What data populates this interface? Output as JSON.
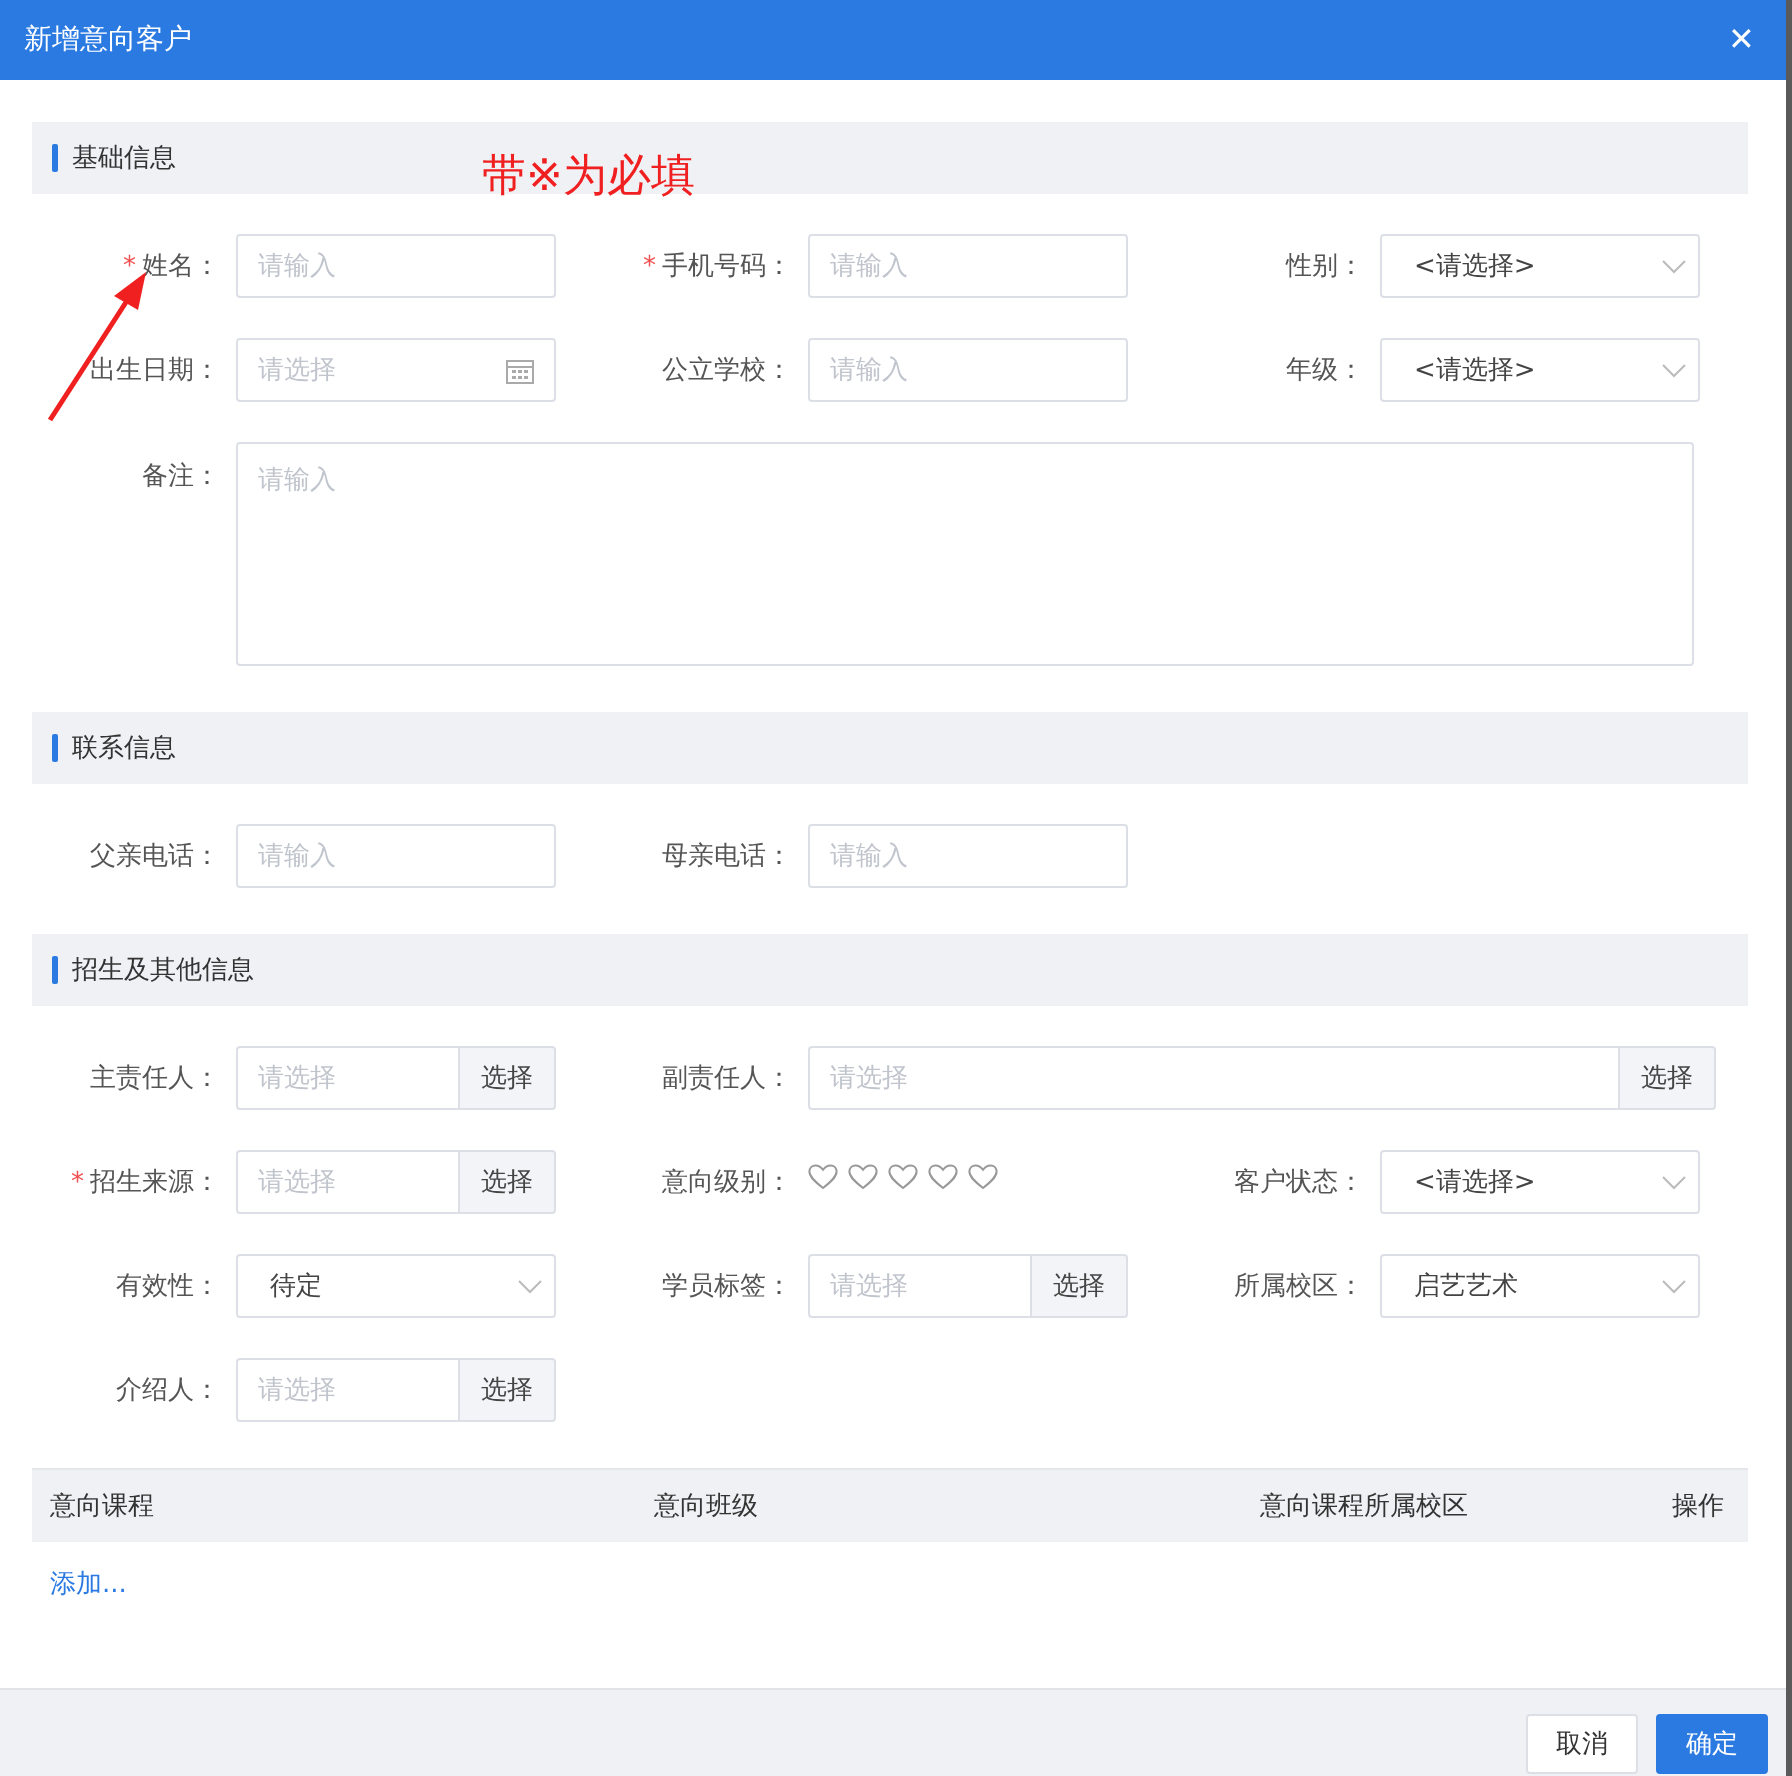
{
  "window": {
    "title": "新增意向客户",
    "close": "✕"
  },
  "annotation": {
    "text": "带※为必填"
  },
  "sections": [
    {
      "title": "基础信息",
      "rows": [
        [
          {
            "label": "姓名：",
            "required_mark": "*",
            "kind": "text",
            "placeholder": "请输入"
          },
          {
            "label": "手机号码：",
            "required_mark": "*",
            "kind": "text",
            "placeholder": "请输入"
          },
          {
            "label": "性别：",
            "kind": "select",
            "value": "<请选择>"
          }
        ],
        [
          {
            "label": "出生日期：",
            "kind": "date",
            "placeholder": "请选择"
          },
          {
            "label": "公立学校：",
            "kind": "text",
            "placeholder": "请输入"
          },
          {
            "label": "年级：",
            "kind": "select",
            "value": "<请选择>"
          }
        ],
        [
          {
            "label": "备注：",
            "kind": "textarea",
            "placeholder": "请输入"
          }
        ]
      ]
    },
    {
      "title": "联系信息",
      "rows": [
        [
          {
            "label": "父亲电话：",
            "kind": "text",
            "placeholder": "请输入"
          },
          {
            "label": "母亲电话：",
            "kind": "text",
            "placeholder": "请输入"
          }
        ]
      ]
    },
    {
      "title": "招生及其他信息",
      "rows": [
        [
          {
            "label": "主责任人：",
            "kind": "picker",
            "placeholder": "请选择",
            "button": "选择"
          },
          {
            "label": "副责任人：",
            "kind": "picker",
            "placeholder": "请选择",
            "button": "选择",
            "wide": true
          }
        ],
        [
          {
            "label": "招生来源：",
            "required_mark": "*",
            "kind": "picker",
            "placeholder": "请选择",
            "button": "选择"
          },
          {
            "label": "意向级别：",
            "kind": "rating",
            "stars": 0
          },
          {
            "label": "客户状态：",
            "kind": "select",
            "value": "<请选择>"
          }
        ],
        [
          {
            "label": "有效性：",
            "kind": "select",
            "value": "待定"
          },
          {
            "label": "学员标签：",
            "kind": "picker",
            "placeholder": "请选择",
            "button": "选择"
          },
          {
            "label": "所属校区：",
            "kind": "select",
            "value": "启艺艺术"
          }
        ],
        [
          {
            "label": "介绍人：",
            "kind": "picker",
            "placeholder": "请选择",
            "button": "选择"
          }
        ]
      ]
    }
  ],
  "table": {
    "columns": [
      "意向课程",
      "意向班级",
      "意向课程所属校区",
      "操作"
    ],
    "add_link": "添加..."
  },
  "buttons": [
    {
      "label": "取消",
      "primary": false
    },
    {
      "label": "确定",
      "primary": true
    }
  ]
}
